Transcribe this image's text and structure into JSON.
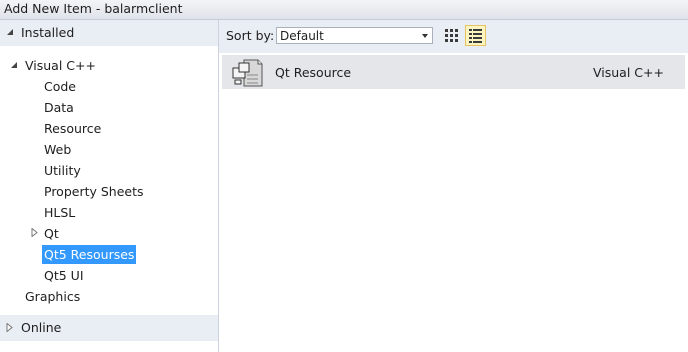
{
  "window": {
    "title": "Add New Item - balarmclient"
  },
  "left_panel": {
    "installed_label": "Installed",
    "tree": {
      "root_label": "Visual C++",
      "children": [
        {
          "label": "Code"
        },
        {
          "label": "Data"
        },
        {
          "label": "Resource"
        },
        {
          "label": "Web"
        },
        {
          "label": "Utility"
        },
        {
          "label": "Property Sheets"
        },
        {
          "label": "HLSL"
        },
        {
          "label": "Qt"
        },
        {
          "label": "Qt5 Resourses",
          "selected": true
        },
        {
          "label": "Qt5 UI"
        }
      ],
      "graphics_label": "Graphics"
    },
    "online_label": "Online"
  },
  "toolbar": {
    "sort_label": "Sort by:",
    "sort_value": "Default",
    "view_modes": [
      "grid-view-icon",
      "list-view-icon"
    ],
    "active_view": "list-view-icon"
  },
  "items": [
    {
      "name": "Qt Resource",
      "type": "Visual C++",
      "icon": "qt-resource-file-icon"
    }
  ],
  "colors": {
    "selection": "#3399ff",
    "header_bg": "#e9edf4",
    "item_row_bg": "#e4e6ea",
    "active_view_bg": "#fdf4bf"
  }
}
